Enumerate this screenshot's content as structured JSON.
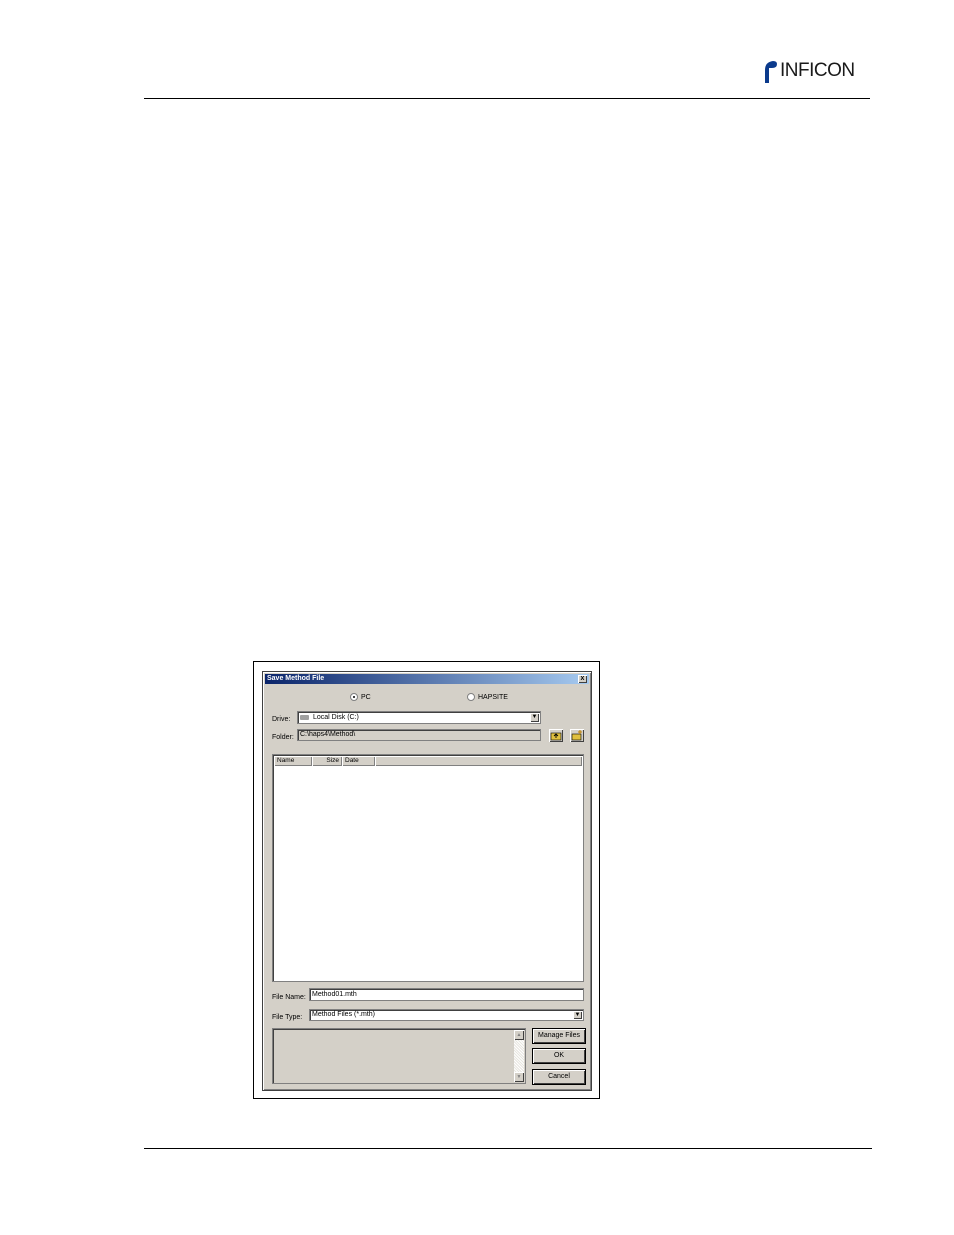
{
  "brand": {
    "logo_text": "INFICON"
  },
  "dialog": {
    "title": "Save Method File",
    "close_label": "x",
    "location": {
      "pc_label": "PC",
      "hapsite_label": "HAPSITE",
      "selected": "PC"
    },
    "drive": {
      "label": "Drive:",
      "value": "Local Disk (C:)"
    },
    "folder": {
      "label": "Folder:",
      "value": "C:\\haps4\\Method\\"
    },
    "file_list": {
      "columns": [
        "Name",
        "Size",
        "Date"
      ],
      "rows": []
    },
    "file_name": {
      "label": "File Name:",
      "value": "Method01.mth"
    },
    "file_type": {
      "label": "File Type:",
      "value": "Method Files (*.mth)"
    },
    "buttons": {
      "manage_files": "Manage Files",
      "ok": "OK",
      "cancel": "Cancel"
    },
    "icons": [
      "folder-up-icon",
      "new-folder-icon",
      "drive-icon",
      "chevron-down-icon"
    ]
  }
}
